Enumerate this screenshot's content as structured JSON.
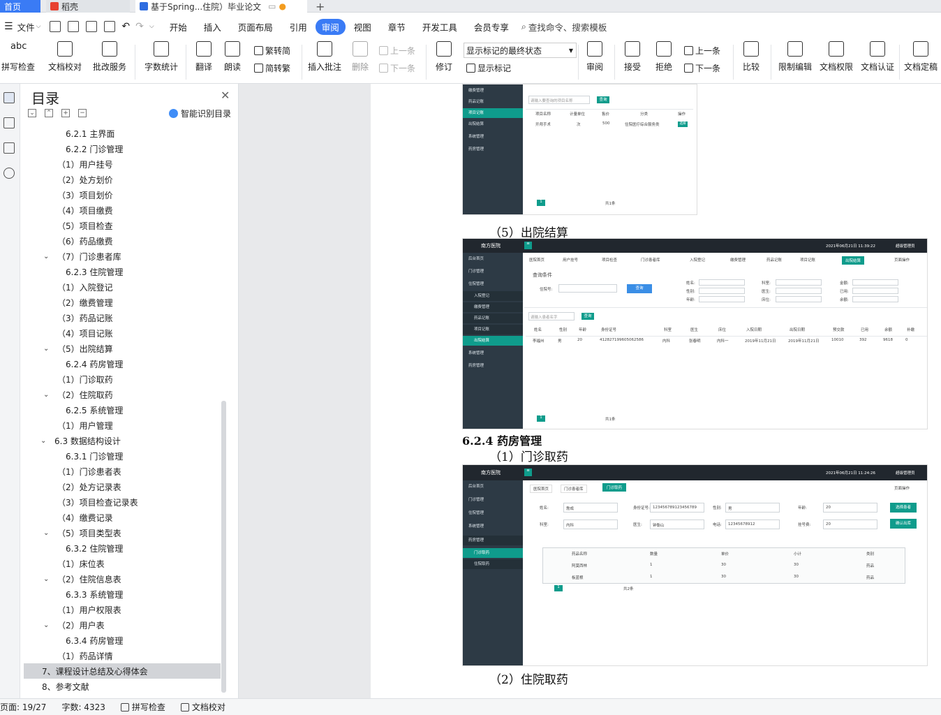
{
  "tabs": [
    {
      "label": "首页"
    },
    {
      "label": "稻壳"
    },
    {
      "label": "基于Spring...住院）毕业论文"
    }
  ],
  "menu": {
    "file": "文件",
    "items": [
      "开始",
      "插入",
      "页面布局",
      "引用",
      "审阅",
      "视图",
      "章节",
      "开发工具",
      "会员专享"
    ],
    "active": "审阅",
    "search": "查找命令、搜索模板"
  },
  "ribbon": {
    "spellcheck": "拼写检查",
    "doccheck": "文档校对",
    "batch": "批改服务",
    "wordcount": "字数统计",
    "translate": "翻译",
    "read": "朗读",
    "trad": "繁转简",
    "simp": "简转繁",
    "insert_comment": "插入批注",
    "delete": "删除",
    "prev_comment": "上一条",
    "next_comment": "下一条",
    "revise": "修订",
    "display_select": "显示标记的最终状态",
    "show_markup": "显示标记",
    "review": "审阅",
    "accept": "接受",
    "reject": "拒绝",
    "prev": "上一条",
    "next": "下一条",
    "compare": "比较",
    "restrict": "限制编辑",
    "permission": "文档权限",
    "certify": "文档认证",
    "finalize": "文档定稿"
  },
  "toc": {
    "title": "目录",
    "ai_label": "智能识别目录",
    "items": [
      {
        "text": "6.2.1 主界面",
        "indent": 2
      },
      {
        "text": "6.2.2 门诊管理",
        "indent": 2
      },
      {
        "text": "（1）用户挂号",
        "indent": 1
      },
      {
        "text": "（2）处方划价",
        "indent": 1
      },
      {
        "text": "（3）项目划价",
        "indent": 1
      },
      {
        "text": "（4）项目缴费",
        "indent": 1
      },
      {
        "text": "（5）项目检查",
        "indent": 1
      },
      {
        "text": "（6）药品缴费",
        "indent": 1
      },
      {
        "text": "（7）门诊患者库",
        "indent": 1,
        "chevron": true
      },
      {
        "text": "6.2.3 住院管理",
        "indent": 2
      },
      {
        "text": "（1）入院登记",
        "indent": 1
      },
      {
        "text": "（2）缴费管理",
        "indent": 1
      },
      {
        "text": "（3）药品记账",
        "indent": 1
      },
      {
        "text": "（4）项目记账",
        "indent": 1
      },
      {
        "text": "（5）出院结算",
        "indent": 1,
        "chevron": true
      },
      {
        "text": "6.2.4 药房管理",
        "indent": 2
      },
      {
        "text": "（1）门诊取药",
        "indent": 1
      },
      {
        "text": "（2）住院取药",
        "indent": 1,
        "chevron": true
      },
      {
        "text": "6.2.5 系统管理",
        "indent": 2
      },
      {
        "text": "（1）用户管理",
        "indent": 1
      },
      {
        "text": "6.3 数据结构设计",
        "indent": 0,
        "chevron": true
      },
      {
        "text": "6.3.1 门诊管理",
        "indent": 2
      },
      {
        "text": "（1）门诊患者表",
        "indent": 1
      },
      {
        "text": "（2）处方记录表",
        "indent": 1
      },
      {
        "text": "（3）项目检查记录表",
        "indent": 1
      },
      {
        "text": "（4）缴费记录",
        "indent": 1
      },
      {
        "text": "（5）项目类型表",
        "indent": 1,
        "chevron": true
      },
      {
        "text": "6.3.2 住院管理",
        "indent": 2
      },
      {
        "text": "（1）床位表",
        "indent": 1
      },
      {
        "text": "（2）住院信息表",
        "indent": 1,
        "chevron": true
      },
      {
        "text": "6.3.3 系统管理",
        "indent": 2
      },
      {
        "text": "（1）用户权限表",
        "indent": 1
      },
      {
        "text": "（2）用户表",
        "indent": 1,
        "chevron": true
      },
      {
        "text": "6.3.4 药房管理",
        "indent": 2
      },
      {
        "text": "（1）药品详情",
        "indent": 1
      },
      {
        "text": "7、课程设计总结及心得体会",
        "indent": -1,
        "selected": true
      },
      {
        "text": "8、参考文献",
        "indent": -1
      }
    ]
  },
  "document": {
    "caption_settle": "（5）出院结算",
    "heading_pharmacy": "6.2.4 药房管理",
    "caption_outpatient": "（1）门诊取药",
    "caption_inpatient": "（2）住院取药"
  },
  "shot1": {
    "sidebar": [
      "缴费管理",
      "药品记账",
      "项目记账",
      "出院结算",
      "系统管理",
      "药房管理"
    ],
    "search_placeholder": "请输入要查询的项目名称",
    "search_btn": "查询",
    "headers": [
      "项目名称",
      "计量单位",
      "售价",
      "分类",
      "操作"
    ],
    "row": [
      "开颅手术",
      "次",
      "500",
      "住院医疗综合服务类",
      "选择"
    ],
    "pager": "共1条"
  },
  "shot2": {
    "brand": "南方医院",
    "datetime": "2021年06月21日 11:39:22",
    "user": "超级管理员",
    "sidebar": [
      "后台首页",
      "门诊管理",
      "住院管理",
      "入院登记",
      "缴费管理",
      "药品记账",
      "项目记账",
      "出院结算",
      "系统管理",
      "药房管理"
    ],
    "tabs": [
      "医院首页",
      "用户挂号",
      "项目检查",
      "门诊患者库",
      "入院登记",
      "缴费管理",
      "药品记账",
      "项目记账",
      "出院结算"
    ],
    "page_ops": "页面操作",
    "query_title": "查询条件",
    "hospital_no": "住院号:",
    "query_btn": "查询",
    "fields_a": [
      "姓名:",
      "性别:",
      "年龄:"
    ],
    "fields_b": [
      "科室:",
      "医生:",
      "床位:"
    ],
    "fields_c": [
      "金额:",
      "已用:",
      "余额:"
    ],
    "search_placeholder": "请输入患者名字",
    "search_btn": "查询",
    "headers": [
      "姓名",
      "性别",
      "年龄",
      "身份证号",
      "科室",
      "医生",
      "床位",
      "入院日期",
      "出院日期",
      "预交款",
      "已用",
      "余额",
      "补缴"
    ],
    "row": [
      "李福州",
      "男",
      "20",
      "412827199605062586",
      "内科",
      "张春明",
      "内科一",
      "2019年11月21日",
      "2019年11月21日",
      "10010",
      "392",
      "9618",
      "0"
    ],
    "pager": "共1条"
  },
  "shot3": {
    "brand": "南方医院",
    "datetime": "2021年06月21日 11:24:26",
    "user": "超级管理员",
    "sidebar": [
      "后台首页",
      "门诊管理",
      "住院管理",
      "系统管理",
      "药房管理",
      "门诊取药",
      "住院取药"
    ],
    "tabs": [
      "医院首页",
      "门诊患者库",
      "门诊取药"
    ],
    "page_ops": "页面操作",
    "labels": [
      "姓名:",
      "身份证号:",
      "性别:",
      "年龄:",
      "科室:",
      "医生:",
      "电话:",
      "挂号费:"
    ],
    "values": [
      "詹成",
      "123456789123456789",
      "男",
      "20",
      "内科",
      "钟衡山",
      "12345678912",
      "20"
    ],
    "btn_select": "选择患者",
    "btn_confirm": "确认出库",
    "headers": [
      "药品名称",
      "数量",
      "单价",
      "小计",
      "类别"
    ],
    "rows": [
      [
        "阿莫西林",
        "1",
        "30",
        "30",
        "药品"
      ],
      [
        "板蓝根",
        "1",
        "30",
        "30",
        "药品"
      ]
    ],
    "pager": "共2条"
  },
  "status": {
    "page": "页面: 19/27",
    "words": "字数: 4323",
    "spell": "拼写检查",
    "doccheck": "文档校对"
  }
}
